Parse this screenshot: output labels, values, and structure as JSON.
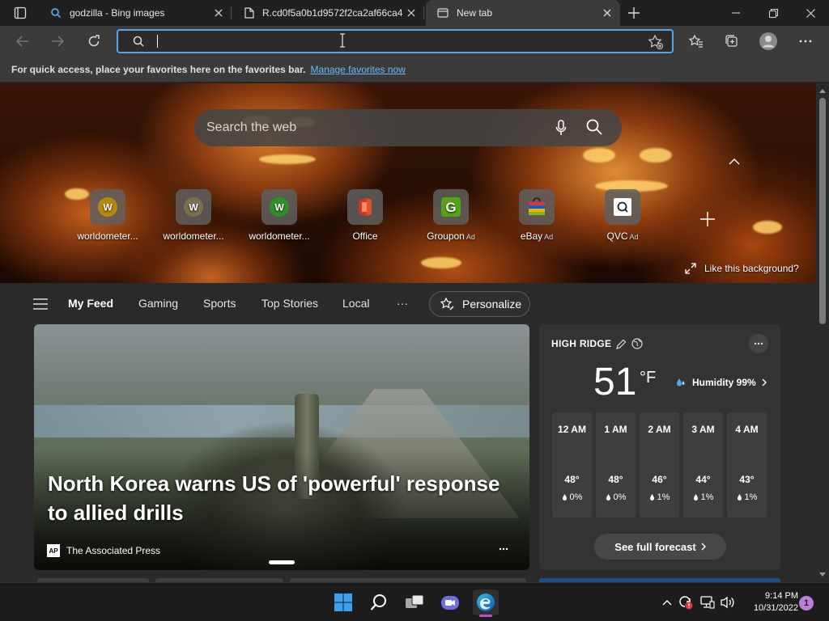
{
  "tabs": [
    {
      "title": "godzilla - Bing images",
      "icon": "search-icon"
    },
    {
      "title": "R.cd0f5a0b1d9572f2ca2af66ca4",
      "icon": "file-icon"
    },
    {
      "title": "New tab",
      "icon": "newtab-icon"
    }
  ],
  "toolbar": {
    "address_value": ""
  },
  "favorites_bar": {
    "text": "For quick access, place your favorites here on the favorites bar.",
    "link": "Manage favorites now"
  },
  "hero": {
    "search_placeholder": "Search the web",
    "like_background": "Like this background?"
  },
  "quick_links": [
    {
      "label": "worldometer...",
      "letter": "W",
      "color": "#b58a0b",
      "ad": ""
    },
    {
      "label": "worldometer...",
      "letter": "W",
      "color": "#7c6f4f",
      "ad": ""
    },
    {
      "label": "worldometer...",
      "letter": "W",
      "color": "#2f8f2a",
      "ad": ""
    },
    {
      "label": "Office",
      "letter": "",
      "color": "#e4502c",
      "ad": ""
    },
    {
      "label": "Groupon",
      "letter": "G",
      "color": "#53a318",
      "ad": "Ad"
    },
    {
      "label": "eBay",
      "letter": "",
      "color": "#e53238",
      "ad": "Ad"
    },
    {
      "label": "QVC",
      "letter": "Q",
      "color": "#ffffff",
      "ad": "Ad"
    }
  ],
  "feed_nav": {
    "items": [
      "My Feed",
      "Gaming",
      "Sports",
      "Top Stories",
      "Local"
    ],
    "more": "···",
    "personalize": "Personalize"
  },
  "news": {
    "headline": "North Korea warns US of 'powerful' response to allied drills",
    "source": "The Associated Press",
    "source_logo": "AP"
  },
  "weather": {
    "location": "HIGH RIDGE",
    "temperature": "51",
    "unit": "°F",
    "humidity": "Humidity 99%",
    "hourly": [
      {
        "time": "12 AM",
        "temp": "48°",
        "precip": "0%"
      },
      {
        "time": "1 AM",
        "temp": "48°",
        "precip": "0%"
      },
      {
        "time": "2 AM",
        "temp": "46°",
        "precip": "1%"
      },
      {
        "time": "3 AM",
        "temp": "44°",
        "precip": "1%"
      },
      {
        "time": "4 AM",
        "temp": "43°",
        "precip": "1%"
      }
    ],
    "forecast_button": "See full forecast"
  },
  "taskbar": {
    "time": "9:14 PM",
    "date": "10/31/2022",
    "notifications": "1"
  },
  "colors": {
    "accent": "#5aa5e6",
    "link": "#6cb8ff",
    "edge_indicator": "#c54bd6"
  }
}
